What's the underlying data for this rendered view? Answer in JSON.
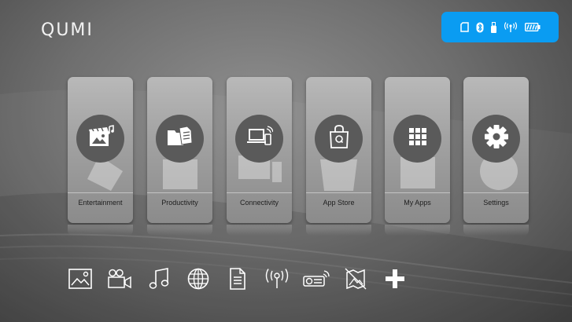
{
  "brand": {
    "logo_text": "QUMI"
  },
  "status_bar": {
    "color": "#0a9cf2",
    "icons": [
      "sd-card-icon",
      "bluetooth-icon",
      "usb-icon",
      "wireless-icon",
      "battery-icon"
    ]
  },
  "tiles": [
    {
      "label": "Entertainment",
      "icon": "media-icon"
    },
    {
      "label": "Productivity",
      "icon": "documents-icon"
    },
    {
      "label": "Connectivity",
      "icon": "laptop-phone-icon"
    },
    {
      "label": "App Store",
      "icon": "shopping-bag-icon"
    },
    {
      "label": "My Apps",
      "icon": "apps-grid-icon"
    },
    {
      "label": "Settings",
      "icon": "gear-icon"
    }
  ],
  "dock": {
    "icons": [
      "photo-icon",
      "video-camera-icon",
      "music-icon",
      "globe-icon",
      "document-icon",
      "wireless-icon",
      "projector-icon",
      "no-image-icon",
      "add-icon"
    ]
  }
}
